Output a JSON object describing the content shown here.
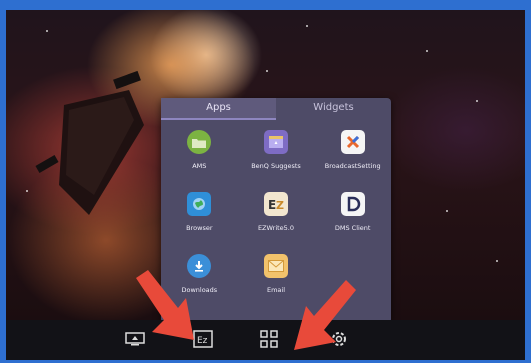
{
  "drawer": {
    "tabs": [
      {
        "label": "Apps",
        "active": true
      },
      {
        "label": "Widgets",
        "active": false
      }
    ],
    "apps": [
      {
        "label": "AMS",
        "icon": "folder-icon",
        "color": "#7cb342"
      },
      {
        "label": "BenQ Suggests",
        "icon": "suggest-box-icon",
        "color": "#7e6cc4"
      },
      {
        "label": "BroadcastSetting",
        "icon": "broadcast-icon",
        "color": "#f5f5f5"
      },
      {
        "label": "Browser",
        "icon": "globe-icon",
        "color": "#2f8fd8"
      },
      {
        "label": "EZWrite5.0",
        "icon": "ezwrite-icon",
        "color": "#f2e6cf"
      },
      {
        "label": "DMS Client",
        "icon": "dms-icon",
        "color": "#f5f5f5"
      },
      {
        "label": "Downloads",
        "icon": "download-icon",
        "color": "#3b8fd8"
      },
      {
        "label": "Email",
        "icon": "envelope-icon",
        "color": "#f2c26b"
      }
    ]
  },
  "taskbar": {
    "buttons": [
      {
        "name": "screen-share-icon"
      },
      {
        "name": "ezwrite-taskbar-icon"
      },
      {
        "name": "apps-grid-icon"
      },
      {
        "name": "settings-gear-icon"
      }
    ]
  },
  "annotation": {
    "arrow_color": "#e84a3a"
  }
}
